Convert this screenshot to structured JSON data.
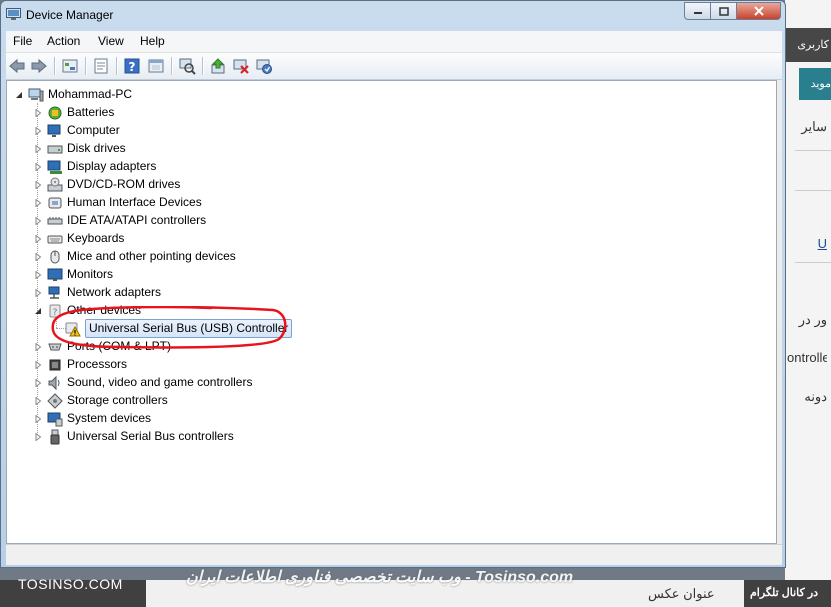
{
  "window": {
    "title": "Device Manager"
  },
  "menu": [
    "File",
    "Action",
    "View",
    "Help"
  ],
  "toolbar": {
    "icons": [
      "back-icon",
      "forward-icon",
      "up-icon",
      "properties-icon",
      "help-icon",
      "show-hidden-icon",
      "scan-hardware-icon",
      "update-driver-icon",
      "uninstall-icon",
      "enable-device-icon"
    ]
  },
  "tree": {
    "root": "Mohammad-PC",
    "items": [
      {
        "label": "Batteries",
        "icon": "battery-icon"
      },
      {
        "label": "Computer",
        "icon": "computer-icon"
      },
      {
        "label": "Disk drives",
        "icon": "disk-drive-icon"
      },
      {
        "label": "Display adapters",
        "icon": "display-adapter-icon"
      },
      {
        "label": "DVD/CD-ROM drives",
        "icon": "dvd-drive-icon"
      },
      {
        "label": "Human Interface Devices",
        "icon": "hid-icon"
      },
      {
        "label": "IDE ATA/ATAPI controllers",
        "icon": "ide-controller-icon"
      },
      {
        "label": "Keyboards",
        "icon": "keyboard-icon"
      },
      {
        "label": "Mice and other pointing devices",
        "icon": "mouse-icon"
      },
      {
        "label": "Monitors",
        "icon": "monitor-icon"
      },
      {
        "label": "Network adapters",
        "icon": "network-adapter-icon"
      },
      {
        "label": "Other devices",
        "icon": "other-devices-icon"
      },
      {
        "label": "Ports (COM & LPT)",
        "icon": "port-icon"
      },
      {
        "label": "Processors",
        "icon": "processor-icon"
      },
      {
        "label": "Sound, video and game controllers",
        "icon": "sound-icon"
      },
      {
        "label": "Storage controllers",
        "icon": "storage-controller-icon"
      },
      {
        "label": "System devices",
        "icon": "system-devices-icon"
      },
      {
        "label": "Universal Serial Bus controllers",
        "icon": "usb-icon"
      }
    ],
    "child": {
      "label": "Universal Serial Bus (USB) Controller",
      "icon": "warning-device-icon"
    }
  },
  "background": {
    "web_button": "مويد",
    "web_top": "كاربری",
    "web_text_1": "ساير",
    "web_text_2": "U",
    "web_text_3": "ور در",
    "web_text_4": "ontroller",
    "web_text_5": "دونه",
    "bottom_caption": "عنوان عكس",
    "bottom_right": "در كانال تلگرام"
  },
  "watermark": {
    "left": "TOSINSO.COM",
    "center": "وب سایت تخصصی فناوری اطلاعات ایران - Tosinso.com"
  },
  "colors": {
    "annotation": "#e8141c",
    "selection": "#d4e5f8"
  }
}
